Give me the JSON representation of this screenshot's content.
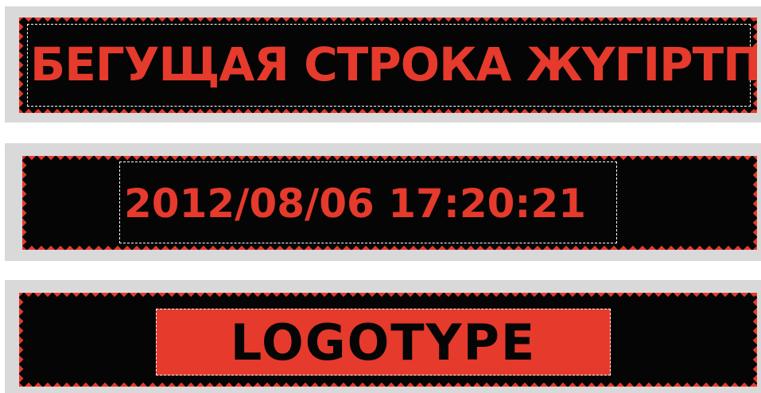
{
  "panels": {
    "scrolling_text": "БЕГУЩАЯ СТРОКА ЖҮГІРТП",
    "datetime": "2012/08/06 17:20:21",
    "logotype": "LOGOTYPE"
  },
  "colors": {
    "led_red": "#e53a2c",
    "panel_black": "#050505",
    "frame_gray": "#d9d9d9"
  }
}
